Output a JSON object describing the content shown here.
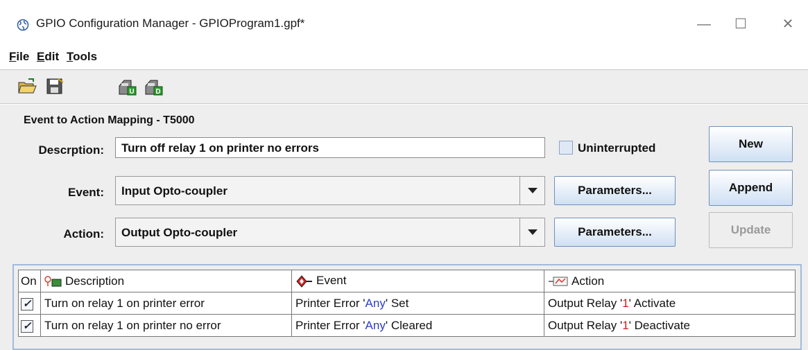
{
  "window": {
    "title": "GPIO Configuration Manager - GPIOProgram1.gpf*",
    "controls": {
      "minimize": "—",
      "maximize": "☐",
      "close": "✕"
    }
  },
  "menu": {
    "file": {
      "mnemonic": "F",
      "rest": "ile"
    },
    "edit": {
      "mnemonic": "E",
      "rest": "dit"
    },
    "tools": {
      "mnemonic": "T",
      "rest": "ools"
    }
  },
  "toolbar": {
    "buttons": [
      "open-folder-icon",
      "save-icon",
      "upload-icon",
      "download-icon"
    ]
  },
  "panel": {
    "title": "Event to Action Mapping - T5000",
    "description_label": "Descrption:",
    "description_value": "Turn off relay 1 on printer no errors",
    "uninterrupted_label": "Uninterrupted",
    "uninterrupted_checked": false,
    "event_label": "Event:",
    "event_value": "Input Opto-coupler",
    "action_label": "Action:",
    "action_value": "Output Opto-coupler",
    "parameters_label": "Parameters...",
    "new_label": "New",
    "append_label": "Append",
    "update_label": "Update",
    "update_enabled": false
  },
  "table": {
    "headers": {
      "on": "On",
      "description": "Description",
      "event": "Event",
      "action": "Action"
    },
    "rows": [
      {
        "on": true,
        "description": "Turn on relay 1 on printer error",
        "event": {
          "pre": "Printer Error '",
          "highlight": "Any",
          "post": "' Set"
        },
        "action": {
          "pre": "Output Relay '",
          "highlight": "1",
          "post": "' Activate"
        }
      },
      {
        "on": true,
        "description": "Turn on relay 1 on printer no error",
        "event": {
          "pre": "Printer Error '",
          "highlight": "Any",
          "post": "' Cleared"
        },
        "action": {
          "pre": "Output Relay '",
          "highlight": "1",
          "post": "' Deactivate"
        }
      }
    ],
    "colors": {
      "highlight_blue": "#2b3ec9",
      "highlight_red": "#d11a1a"
    }
  }
}
